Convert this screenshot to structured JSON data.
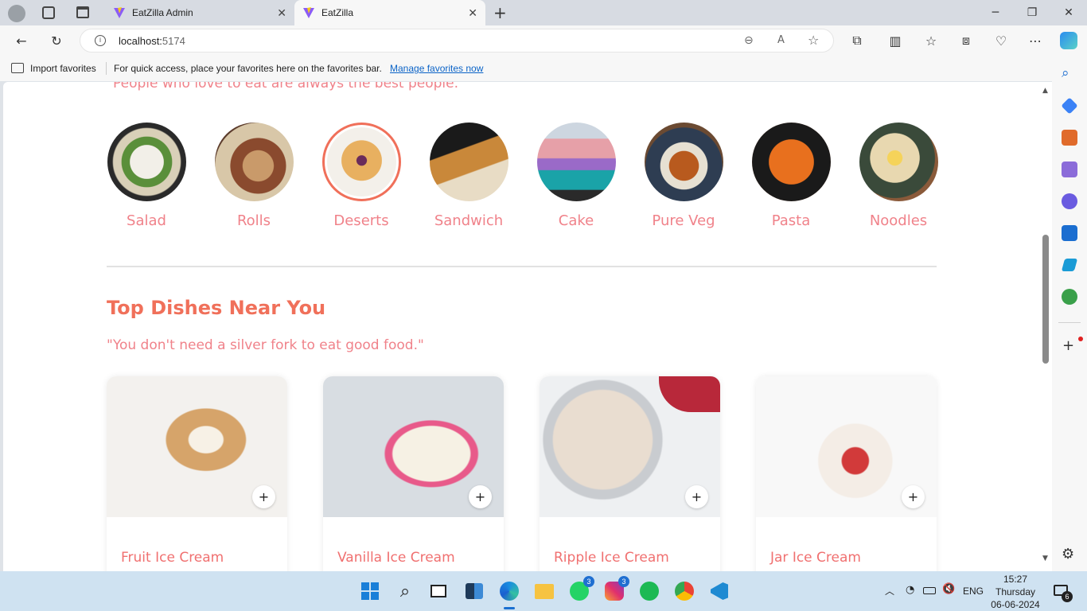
{
  "browser": {
    "tabs": [
      {
        "title": "EatZilla Admin"
      },
      {
        "title": "EatZilla"
      }
    ],
    "url_host": "localhost:",
    "url_port": "5174",
    "favorites": {
      "import_label": "Import favorites",
      "hint": "For quick access, place your favorites here on the favorites bar.",
      "manage_link": "Manage favorites now"
    }
  },
  "page": {
    "top_tagline": "People who love to eat are always the best people.",
    "categories": [
      {
        "label": "Salad"
      },
      {
        "label": "Rolls"
      },
      {
        "label": "Deserts"
      },
      {
        "label": "Sandwich"
      },
      {
        "label": "Cake"
      },
      {
        "label": "Pure Veg"
      },
      {
        "label": "Pasta"
      },
      {
        "label": "Noodles"
      }
    ],
    "section_title": "Top Dishes Near You",
    "section_quote": "\"You don't need a silver fork to eat good food.\"",
    "dishes": [
      {
        "name": "Fruit Ice Cream",
        "add": "+"
      },
      {
        "name": "Vanilla Ice Cream",
        "add": "+"
      },
      {
        "name": "Ripple Ice Cream",
        "add": "+"
      },
      {
        "name": "Jar Ice Cream",
        "add": "+"
      }
    ]
  },
  "taskbar": {
    "whatsapp_badge": "3",
    "instagram_badge": "3",
    "lang": "ENG",
    "time": "15:27",
    "day": "Thursday",
    "date": "06-06-2024",
    "notif_count": "6"
  },
  "colors": {
    "accent": "#f0705a",
    "label": "#f0828a",
    "taskbar": "#cfe2f1"
  }
}
